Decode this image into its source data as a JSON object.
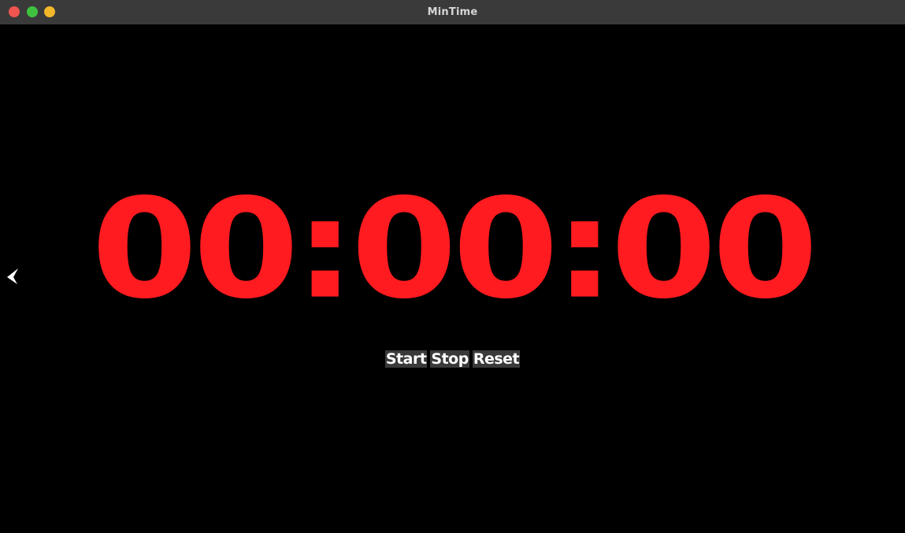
{
  "window": {
    "title": "MinTime"
  },
  "timer": {
    "display": "00:00:00",
    "color": "#ff1b1f"
  },
  "controls": {
    "start_label": "Start",
    "stop_label": "Stop",
    "reset_label": "Reset"
  },
  "icons": {
    "back": "chevron-left-icon"
  }
}
